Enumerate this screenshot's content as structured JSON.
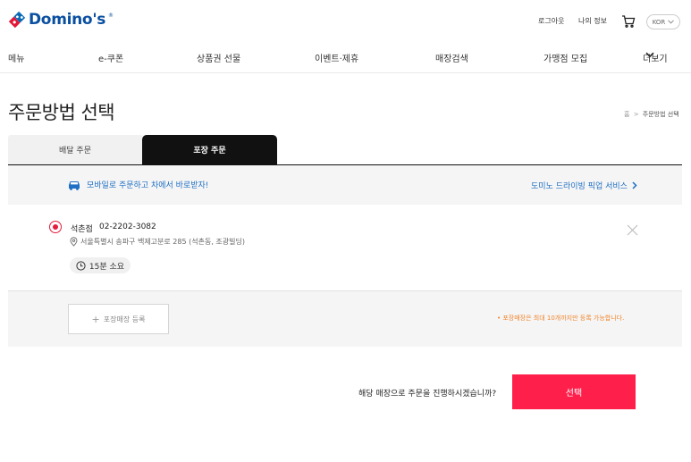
{
  "brand": {
    "logo_text": "Domino's",
    "logo_tm": "®",
    "color": "#0a4fa0"
  },
  "util": {
    "logout": "로그아웃",
    "my_info": "나의 정보",
    "cart_icon": "cart-icon",
    "lang": "KOR"
  },
  "nav": {
    "items": [
      "메뉴",
      "e-쿠폰",
      "상품권 선물",
      "이벤트·제휴",
      "매장검색",
      "가맹점 모집"
    ],
    "more": "더보기"
  },
  "page": {
    "title": "주문방법 선택"
  },
  "breadcrumb": {
    "home": "홈",
    "separator": ">",
    "current": "주문방법 선택"
  },
  "tabs": [
    {
      "label": "배달 주문",
      "active": false
    },
    {
      "label": "포장 주문",
      "active": true
    }
  ],
  "promo": {
    "left_text": "모바일로 주문하고 차에서 바로받자!",
    "right_text": "도미노 드라이빙 픽업 서비스",
    "color": "#1f6fc4"
  },
  "store": {
    "name": "석촌점",
    "phone": "02-2202-3082",
    "address": "서울특별시 송파구 백제고분로 285 (석촌동, 조광빌딩)",
    "time": "15분 소요",
    "selected": true
  },
  "register": {
    "button_label": "포장매장 등록",
    "note": "• 포장매장은 최대 10개까지만 등록 가능합니다.",
    "note_color": "#f0862e"
  },
  "confirm": {
    "question": "해당 매장으로 주문을 진행하시겠습니까?",
    "button_label": "선택",
    "button_color": "#ff1f4b"
  }
}
